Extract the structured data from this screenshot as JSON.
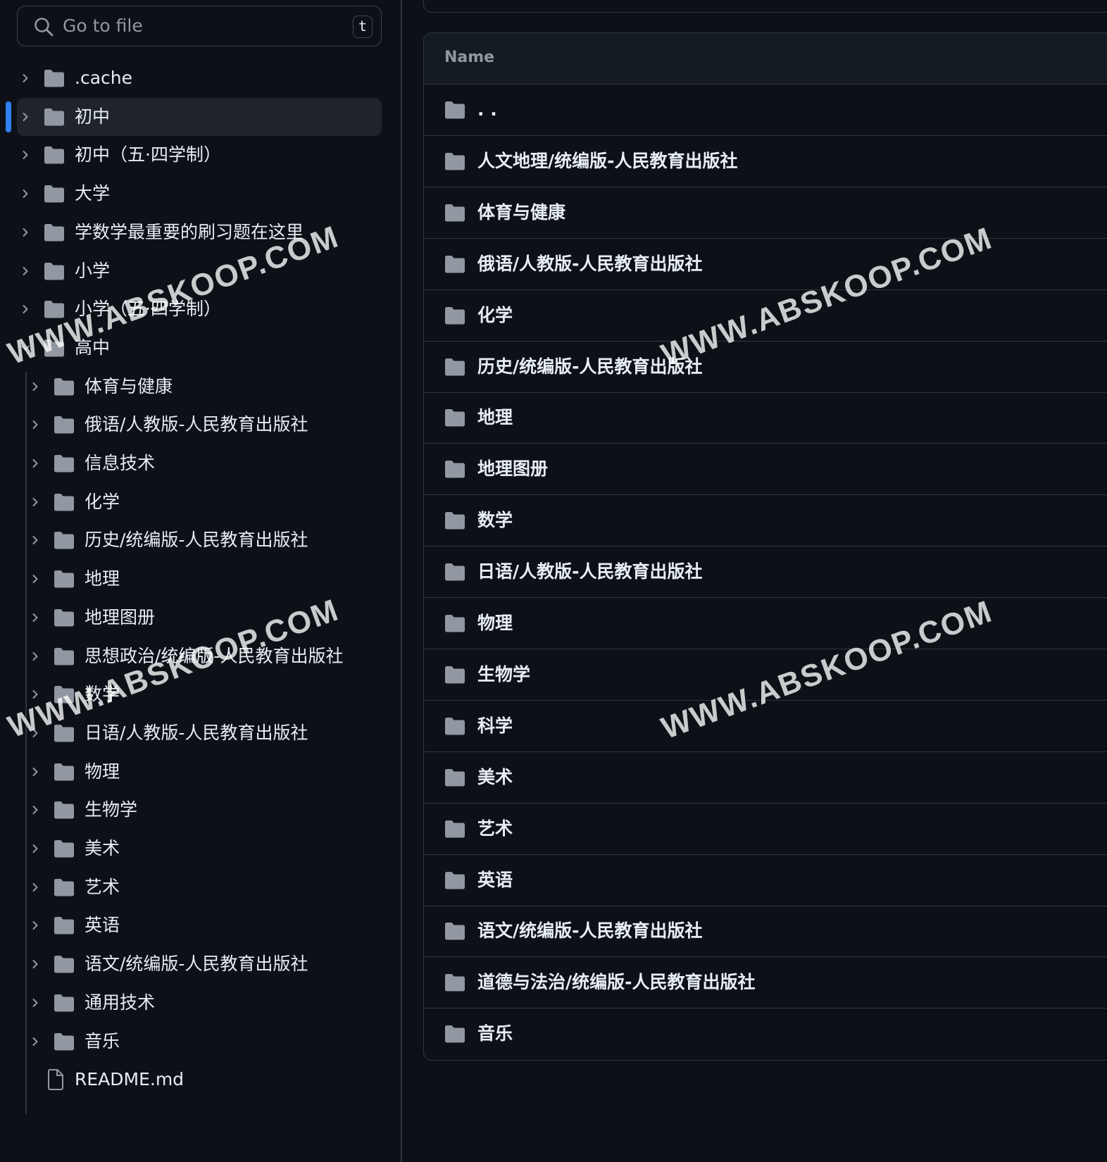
{
  "search": {
    "placeholder": "Go to file",
    "shortcut": "t"
  },
  "sidebar": {
    "items": [
      {
        "label": ".cache",
        "type": "folder",
        "level": 0,
        "expanded": false
      },
      {
        "label": "初中",
        "type": "folder",
        "level": 0,
        "expanded": false,
        "selected": true
      },
      {
        "label": "初中（五·四学制）",
        "type": "folder",
        "level": 0,
        "expanded": false
      },
      {
        "label": "大学",
        "type": "folder",
        "level": 0,
        "expanded": false
      },
      {
        "label": "学数学最重要的刷习题在这里",
        "type": "folder",
        "level": 0,
        "expanded": false
      },
      {
        "label": "小学",
        "type": "folder",
        "level": 0,
        "expanded": false
      },
      {
        "label": "小学（五·四学制）",
        "type": "folder",
        "level": 0,
        "expanded": false
      },
      {
        "label": "高中",
        "type": "folder",
        "level": 0,
        "expanded": true
      },
      {
        "label": "体育与健康",
        "type": "folder",
        "level": 1,
        "expanded": false
      },
      {
        "label": "俄语/人教版-人民教育出版社",
        "type": "folder",
        "level": 1,
        "expanded": false
      },
      {
        "label": "信息技术",
        "type": "folder",
        "level": 1,
        "expanded": false
      },
      {
        "label": "化学",
        "type": "folder",
        "level": 1,
        "expanded": false
      },
      {
        "label": "历史/统编版-人民教育出版社",
        "type": "folder",
        "level": 1,
        "expanded": false
      },
      {
        "label": "地理",
        "type": "folder",
        "level": 1,
        "expanded": false
      },
      {
        "label": "地理图册",
        "type": "folder",
        "level": 1,
        "expanded": false
      },
      {
        "label": "思想政治/统编版-人民教育出版社",
        "type": "folder",
        "level": 1,
        "expanded": false
      },
      {
        "label": "数学",
        "type": "folder",
        "level": 1,
        "expanded": false
      },
      {
        "label": "日语/人教版-人民教育出版社",
        "type": "folder",
        "level": 1,
        "expanded": false
      },
      {
        "label": "物理",
        "type": "folder",
        "level": 1,
        "expanded": false
      },
      {
        "label": "生物学",
        "type": "folder",
        "level": 1,
        "expanded": false
      },
      {
        "label": "美术",
        "type": "folder",
        "level": 1,
        "expanded": false
      },
      {
        "label": "艺术",
        "type": "folder",
        "level": 1,
        "expanded": false
      },
      {
        "label": "英语",
        "type": "folder",
        "level": 1,
        "expanded": false
      },
      {
        "label": "语文/统编版-人民教育出版社",
        "type": "folder",
        "level": 1,
        "expanded": false
      },
      {
        "label": "通用技术",
        "type": "folder",
        "level": 1,
        "expanded": false
      },
      {
        "label": "音乐",
        "type": "folder",
        "level": 1,
        "expanded": false
      },
      {
        "label": "README.md",
        "type": "file",
        "level": 0
      }
    ]
  },
  "table": {
    "header": {
      "name": "Name"
    },
    "rows": [
      ". .",
      "人文地理/统编版-人民教育出版社",
      "体育与健康",
      "俄语/人教版-人民教育出版社",
      "化学",
      "历史/统编版-人民教育出版社",
      "地理",
      "地理图册",
      "数学",
      "日语/人教版-人民教育出版社",
      "物理",
      "生物学",
      "科学",
      "美术",
      "艺术",
      "英语",
      "语文/统编版-人民教育出版社",
      "道德与法治/统编版-人民教育出版社",
      "音乐"
    ]
  },
  "watermark": {
    "text": "WWW.ABSKOOP.COM"
  },
  "colors": {
    "background": "#0d1117",
    "selected_bg": "#1f242c",
    "accent": "#2f81f7",
    "border": "#30363d",
    "icon": "#9198a1",
    "text": "#e6edf3",
    "muted_text": "#9198a1"
  }
}
